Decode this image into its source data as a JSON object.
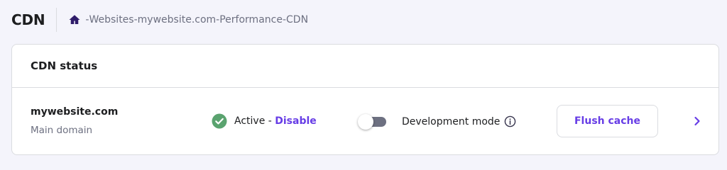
{
  "header": {
    "title": "CDN",
    "breadcrumb": [
      "Websites",
      "mywebsite.com",
      "Performance",
      "CDN"
    ],
    "separator": " - "
  },
  "card": {
    "title": "CDN status",
    "domain": "mywebsite.com",
    "domain_sub": "Main domain",
    "status_text": "Active - ",
    "disable_label": "Disable",
    "dev_mode_label": "Development mode",
    "dev_mode_enabled": false,
    "flush_label": "Flush cache"
  },
  "icons": {
    "home": "home-icon",
    "status": "check-circle-icon",
    "info": "info-icon",
    "chevron": "chevron-right-icon"
  },
  "colors": {
    "accent": "#673de6",
    "success": "#5aa36f",
    "muted": "#6d7081",
    "background": "#f4f4fb"
  }
}
